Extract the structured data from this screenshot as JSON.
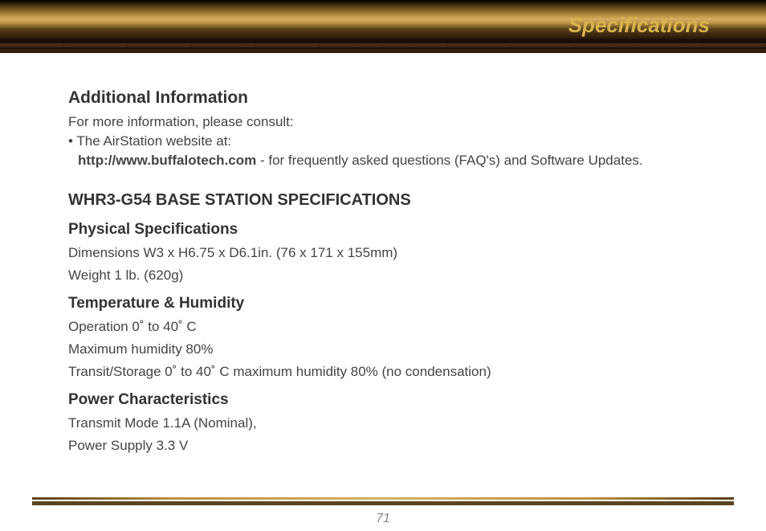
{
  "header": {
    "title": "Specifications"
  },
  "sections": {
    "additional_info": {
      "heading": "Additional Information",
      "intro": "For more information, please consult:",
      "bullet": "• The AirStation website at:",
      "url": "http://www.buffalotech.com",
      "url_suffix": " - for frequently asked questions (FAQ's) and Software Updates."
    },
    "base_station": {
      "heading": "WHR3-G54 BASE STATION SPECIFICATIONS"
    },
    "physical": {
      "heading": "Physical Specifications",
      "dimensions": "Dimensions W3 x H6.75 x D6.1in. (76 x 171 x 155mm)",
      "weight": "Weight 1 lb. (620g)"
    },
    "temperature": {
      "heading": "Temperature & Humidity",
      "operation": "Operation 0˚ to 40˚ C",
      "humidity": "Maximum humidity 80%",
      "storage": "Transit/Storage 0˚ to 40˚ C maximum humidity 80% (no condensation)"
    },
    "power": {
      "heading": "Power Characteristics",
      "transmit": "Transmit Mode 1.1A (Nominal),",
      "supply": "Power Supply 3.3 V"
    }
  },
  "footer": {
    "page_number": "71"
  }
}
